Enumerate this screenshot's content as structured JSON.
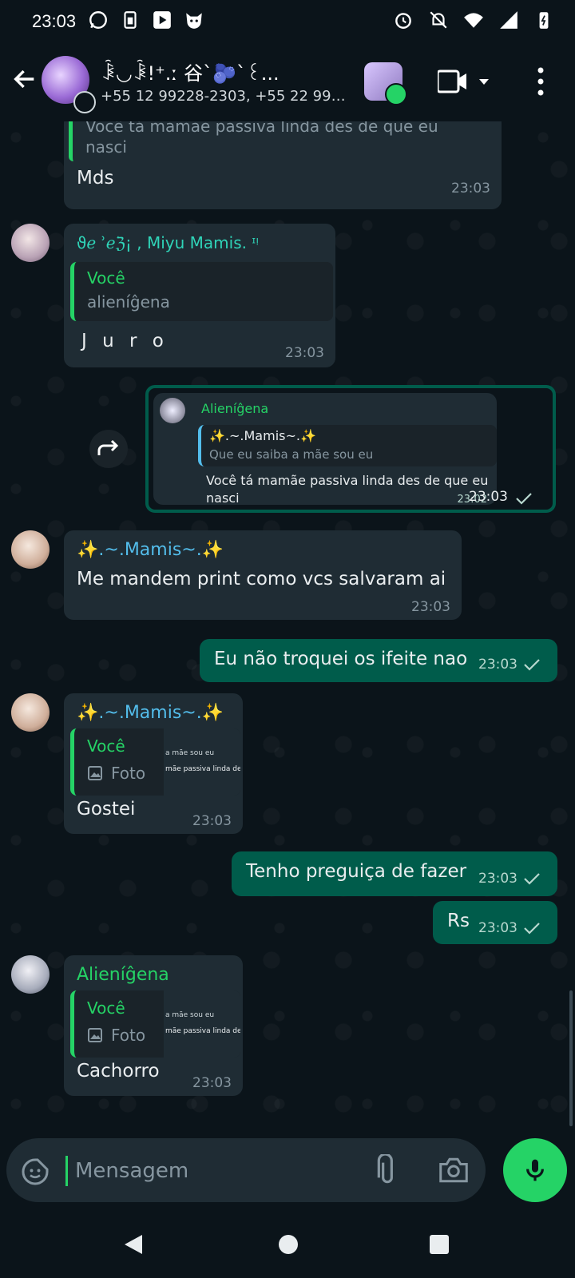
{
  "status_bar": {
    "time": "23:03"
  },
  "header": {
    "title": "ꀳ◡ꀳ!⁺.ː ⾕ˋ🫐ˋ꒰...",
    "subtitle": "+55 12 99228-2303, +55 22 99921-..."
  },
  "messages": {
    "m1": {
      "quote_text": "Você tá mamãe passiva linda des de que eu",
      "quote_text2": "nasci",
      "text": "Mds",
      "time": "23:03"
    },
    "m2": {
      "sender": "ϑℯ ʾℯℨ¡ , Miyu Mamis. ᶦᵎ",
      "quote_name": "Você",
      "quote_text": "alieníĝena",
      "text": "J u r o",
      "time": "23:03"
    },
    "m3": {
      "inner_sender": "Alieníĝena",
      "inner_quote_name": "✨.~.Mamis~.✨",
      "inner_quote_text": "Que eu saiba a mãe sou eu",
      "inner_text": "Você tá mamãe passiva linda des de que eu",
      "inner_text2": "nasci",
      "inner_time": "23:02",
      "time": "23:03"
    },
    "m4": {
      "sender": "✨.~.Mamis~.✨",
      "text": "Me mandem print como vcs salvaram ai",
      "time": "23:03"
    },
    "m5": {
      "text": "Eu não troquei os ifeite nao",
      "time": "23:03"
    },
    "m6": {
      "sender": "✨.~.Mamis~.✨",
      "quote_name": "Você",
      "quote_label": "Foto",
      "thumb_line1": "a mãe sou eu",
      "thumb_line2": "mãe passiva linda des",
      "text": "Gostei",
      "time": "23:03"
    },
    "m7": {
      "text": "Tenho preguiça de fazer",
      "time": "23:03"
    },
    "m8": {
      "text": "Rs",
      "time": "23:03"
    },
    "m9": {
      "sender": "Alieníĝena",
      "quote_name": "Você",
      "quote_label": "Foto",
      "thumb_line1": "a mãe sou eu",
      "thumb_line2": "mãe passiva linda des",
      "text": "Cachorro",
      "time": "23:03"
    }
  },
  "composer": {
    "placeholder": "Mensagem"
  },
  "colors": {
    "accent": "#25d366",
    "outgoing": "#005c4b",
    "incoming": "#1f2c34",
    "background": "#0b141a"
  },
  "icons": [
    "whatsapp-icon",
    "battery-icon",
    "play-icon",
    "cat-icon",
    "alarm-icon",
    "mute-icon",
    "wifi-icon",
    "signal-icon",
    "forward-icon",
    "photo-icon",
    "sticker-icon",
    "attach-icon",
    "camera-icon",
    "mic-icon"
  ]
}
